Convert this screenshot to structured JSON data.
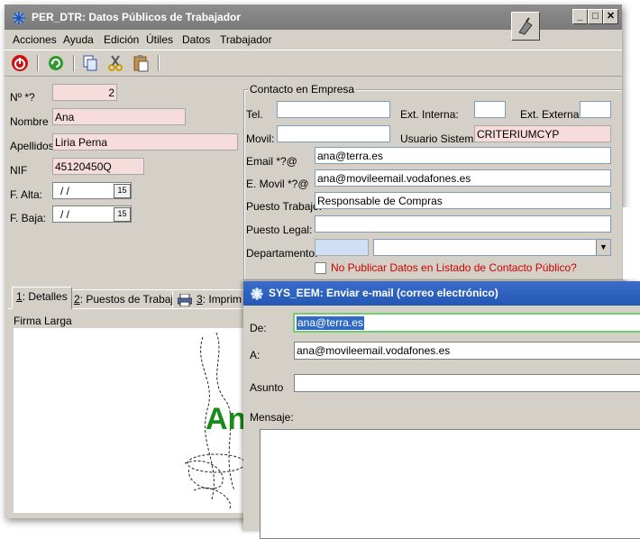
{
  "window": {
    "title": "PER_DTR: Datos Públicos de Trabajador"
  },
  "menu": [
    "Acciones",
    "Ayuda",
    "Edición",
    "Útiles",
    "Datos",
    "Trabajador"
  ],
  "form": {
    "num_label": "Nº *?",
    "num_value": "2",
    "nombre_label": "Nombre",
    "nombre_value": "Ana",
    "apellidos_label": "Apellidos",
    "apellidos_value": "Liria Perna",
    "nif_label": "NIF",
    "nif_value": "45120450Q",
    "falta_label": "F. Alta:",
    "falta_value": "/ /",
    "fbaja_label": "F. Baja:",
    "fbaja_value": "/ /",
    "date_btn": "15"
  },
  "contact": {
    "group_title": "Contacto en Empresa",
    "tel_label": "Tel.",
    "ext_interna_label": "Ext. Interna:",
    "ext_externa_label": "Ext. Externa:",
    "movil_label": "Movil:",
    "usuario_label": "Usuario Sistema:",
    "usuario_value": "CRITERIUMCYP",
    "email_label": "Email *?@",
    "email_value": "ana@terra.es",
    "emovil_label": "E. Movil *?@",
    "emovil_value": "ana@movileemail.vodafones.es",
    "puesto_label": "Puesto Trabajo:",
    "puesto_value": "Responsable de Compras",
    "legal_label": "Puesto Legal:",
    "depto_label": "Departamento:",
    "nopublicar_label": "No Publicar Datos en Listado de Contacto Público?"
  },
  "tabs": [
    {
      "num": "1",
      "label": ": Detalles"
    },
    {
      "num": "2",
      "label": ": Puestos de Trabajo"
    },
    {
      "num": "3",
      "label": ": Imprim"
    }
  ],
  "details": {
    "firma_label": "Firma Larga",
    "firma_text": "An"
  },
  "dialog": {
    "title": "SYS_EEM: Enviar e-mail (correo electrónico)",
    "de_label": "De:",
    "de_value": "ana@terra.es",
    "a_label": "A:",
    "a_value": "ana@movileemail.vodafones.es",
    "asunto_label": "Asunto",
    "mensaje_label": "Mensaje:"
  },
  "colors": {
    "accent": "#2458b5",
    "required_field": "#f7dcdc",
    "lookup_field": "#cfe0f5",
    "error_text": "#cc0000",
    "firma_text": "#1a8a1a"
  }
}
